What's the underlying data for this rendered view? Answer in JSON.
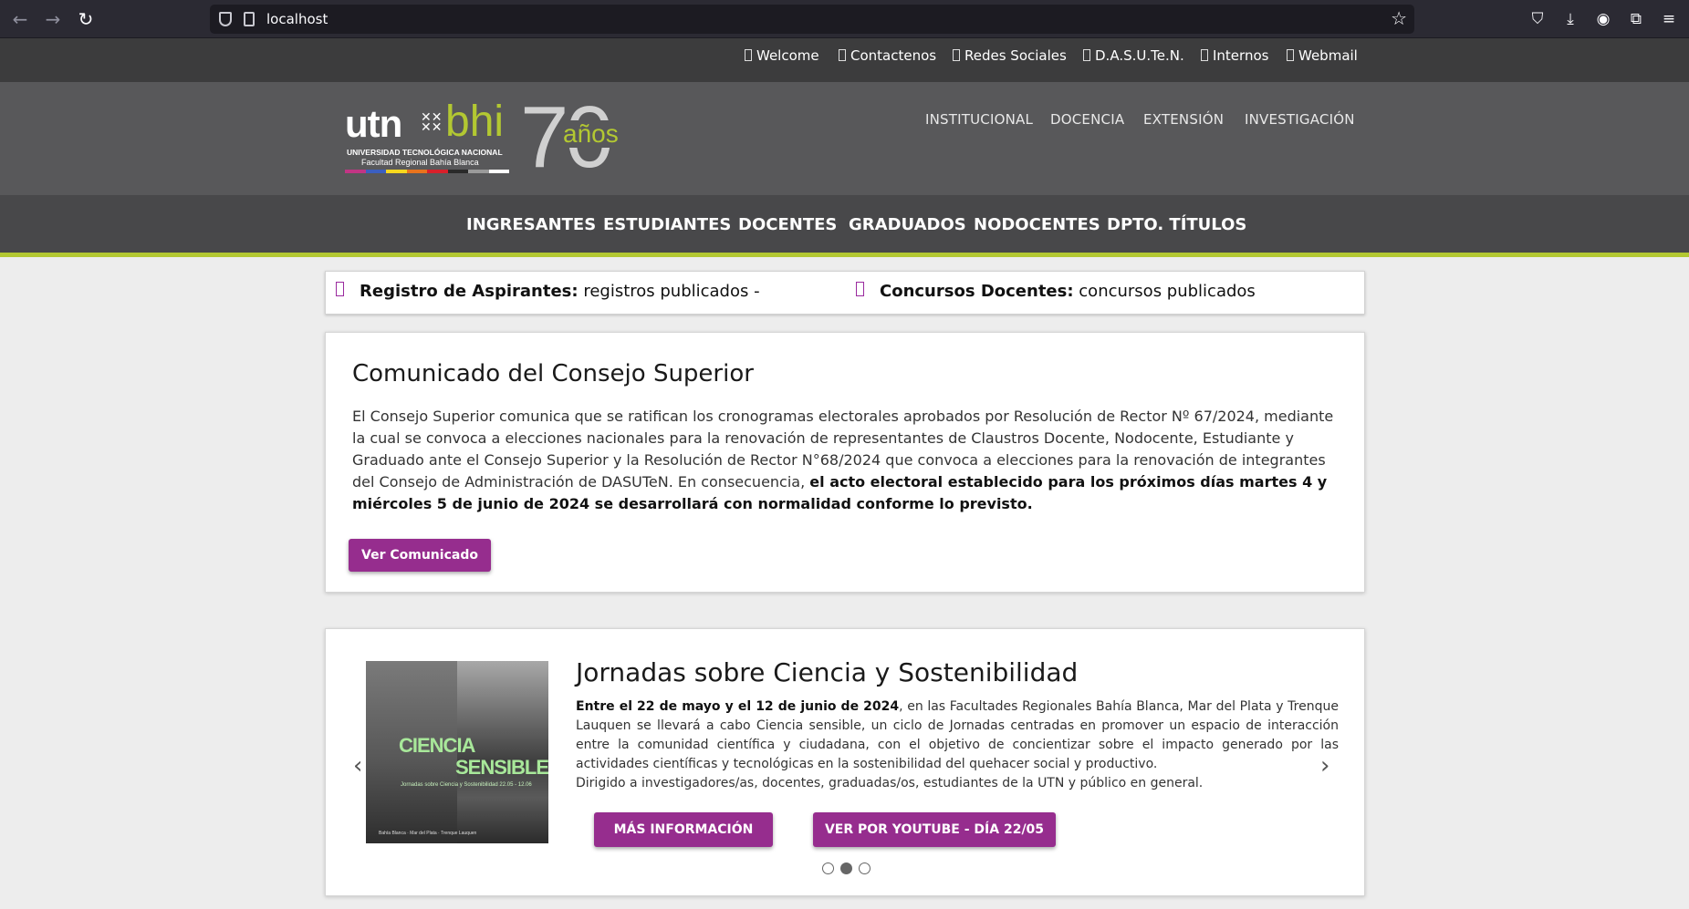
{
  "browser": {
    "back": "←",
    "forward": "→",
    "reload": "↻",
    "url": "localhost",
    "star": "☆",
    "icons": [
      "pocket-icon",
      "download-icon",
      "account-icon",
      "extensions-icon",
      "menu-icon"
    ]
  },
  "util_links": [
    "Welcome",
    "Contactenos",
    "Redes Sociales",
    "D.A.S.U.Te.N.",
    "Internos",
    "Webmail"
  ],
  "logo": {
    "utn": "utn",
    "bhi": "bhi",
    "univ": "UNIVERSIDAD TECNOLÓGICA NACIONAL",
    "fac": "Facultad Regional Bahía Blanca",
    "seventy": "70",
    "anos": "años",
    "stripe_colors": [
      "#c13584",
      "#3b5fc0",
      "#f7d81e",
      "#e8731d",
      "#d8202b",
      "#2a2a2a",
      "#9a9a9a",
      "#ffffff"
    ]
  },
  "main_nav": [
    "INSTITUCIONAL",
    "DOCENCIA",
    "EXTENSIÓN",
    "INVESTIGACIÓN"
  ],
  "category_nav": [
    "INGRESANTES",
    "ESTUDIANTES",
    "DOCENTES",
    "GRADUADOS",
    "NODOCENTES",
    "DPTO. TÍTULOS"
  ],
  "ticker": [
    {
      "label": "Registro de Aspirantes:",
      "text": "registros publicados -"
    },
    {
      "label": "Concursos Docentes:",
      "text": "concursos publicados"
    }
  ],
  "announcement": {
    "title": "Comunicado del Consejo Superior",
    "body": "El Consejo Superior comunica que se ratifican los cronogramas electorales aprobados por Resolución de Rector Nº 67/2024, mediante la cual se convoca a elecciones nacionales para la renovación de representantes de Claustros Docente, Nodocente, Estudiante y Graduado ante el Consejo Superior y la Resolución de Rector N°68/2024 que convoca a elecciones para la renovación de integrantes del Consejo de Administración de DASUTeN. En consecuencia,",
    "body_bold": "el acto electoral establecido para los próximos días martes 4 y miércoles 5 de junio de 2024 se desarrollará con normalidad conforme lo previsto.",
    "button": "Ver Comunicado"
  },
  "slide": {
    "image_text_1": "CIENCIA",
    "image_text_2": "SENSIBLE",
    "image_text_3": "Jornadas sobre Ciencia y Sostenibilidad 22.05 - 12.06",
    "image_text_4": "Bahía Blanca · Mar del Plata · Trenque Lauquen",
    "title": "Jornadas sobre Ciencia y Sostenibilidad",
    "body_bold": "Entre el 22 de mayo y el 12 de junio de 2024",
    "body": ", en las Facultades Regionales Bahía Blanca, Mar del Plata y Trenque Lauquen se llevará a cabo Ciencia sensible, un ciclo de Jornadas centradas en promover un espacio de interacción entre la comunidad científica y ciudadana, con el objetivo de concientizar sobre el impacto generado por las actividades científicas y tecnológicas en la sostenibilidad del quehacer social y productivo.",
    "body_2": "Dirigido a investigadores/as, docentes, graduadas/os, estudiantes de la UTN y público en general.",
    "button_1": "MÁS INFORMACIÓN",
    "button_2": "VER POR YOUTUBE - DÍA 22/05",
    "prev": "‹",
    "next": "›",
    "active_dot": 2,
    "dot_count": 3
  },
  "colors": {
    "accent_green": "#b3c832",
    "button_purple": "#962d8e",
    "header_gray": "#58585a",
    "nav_gray": "#48484a"
  }
}
